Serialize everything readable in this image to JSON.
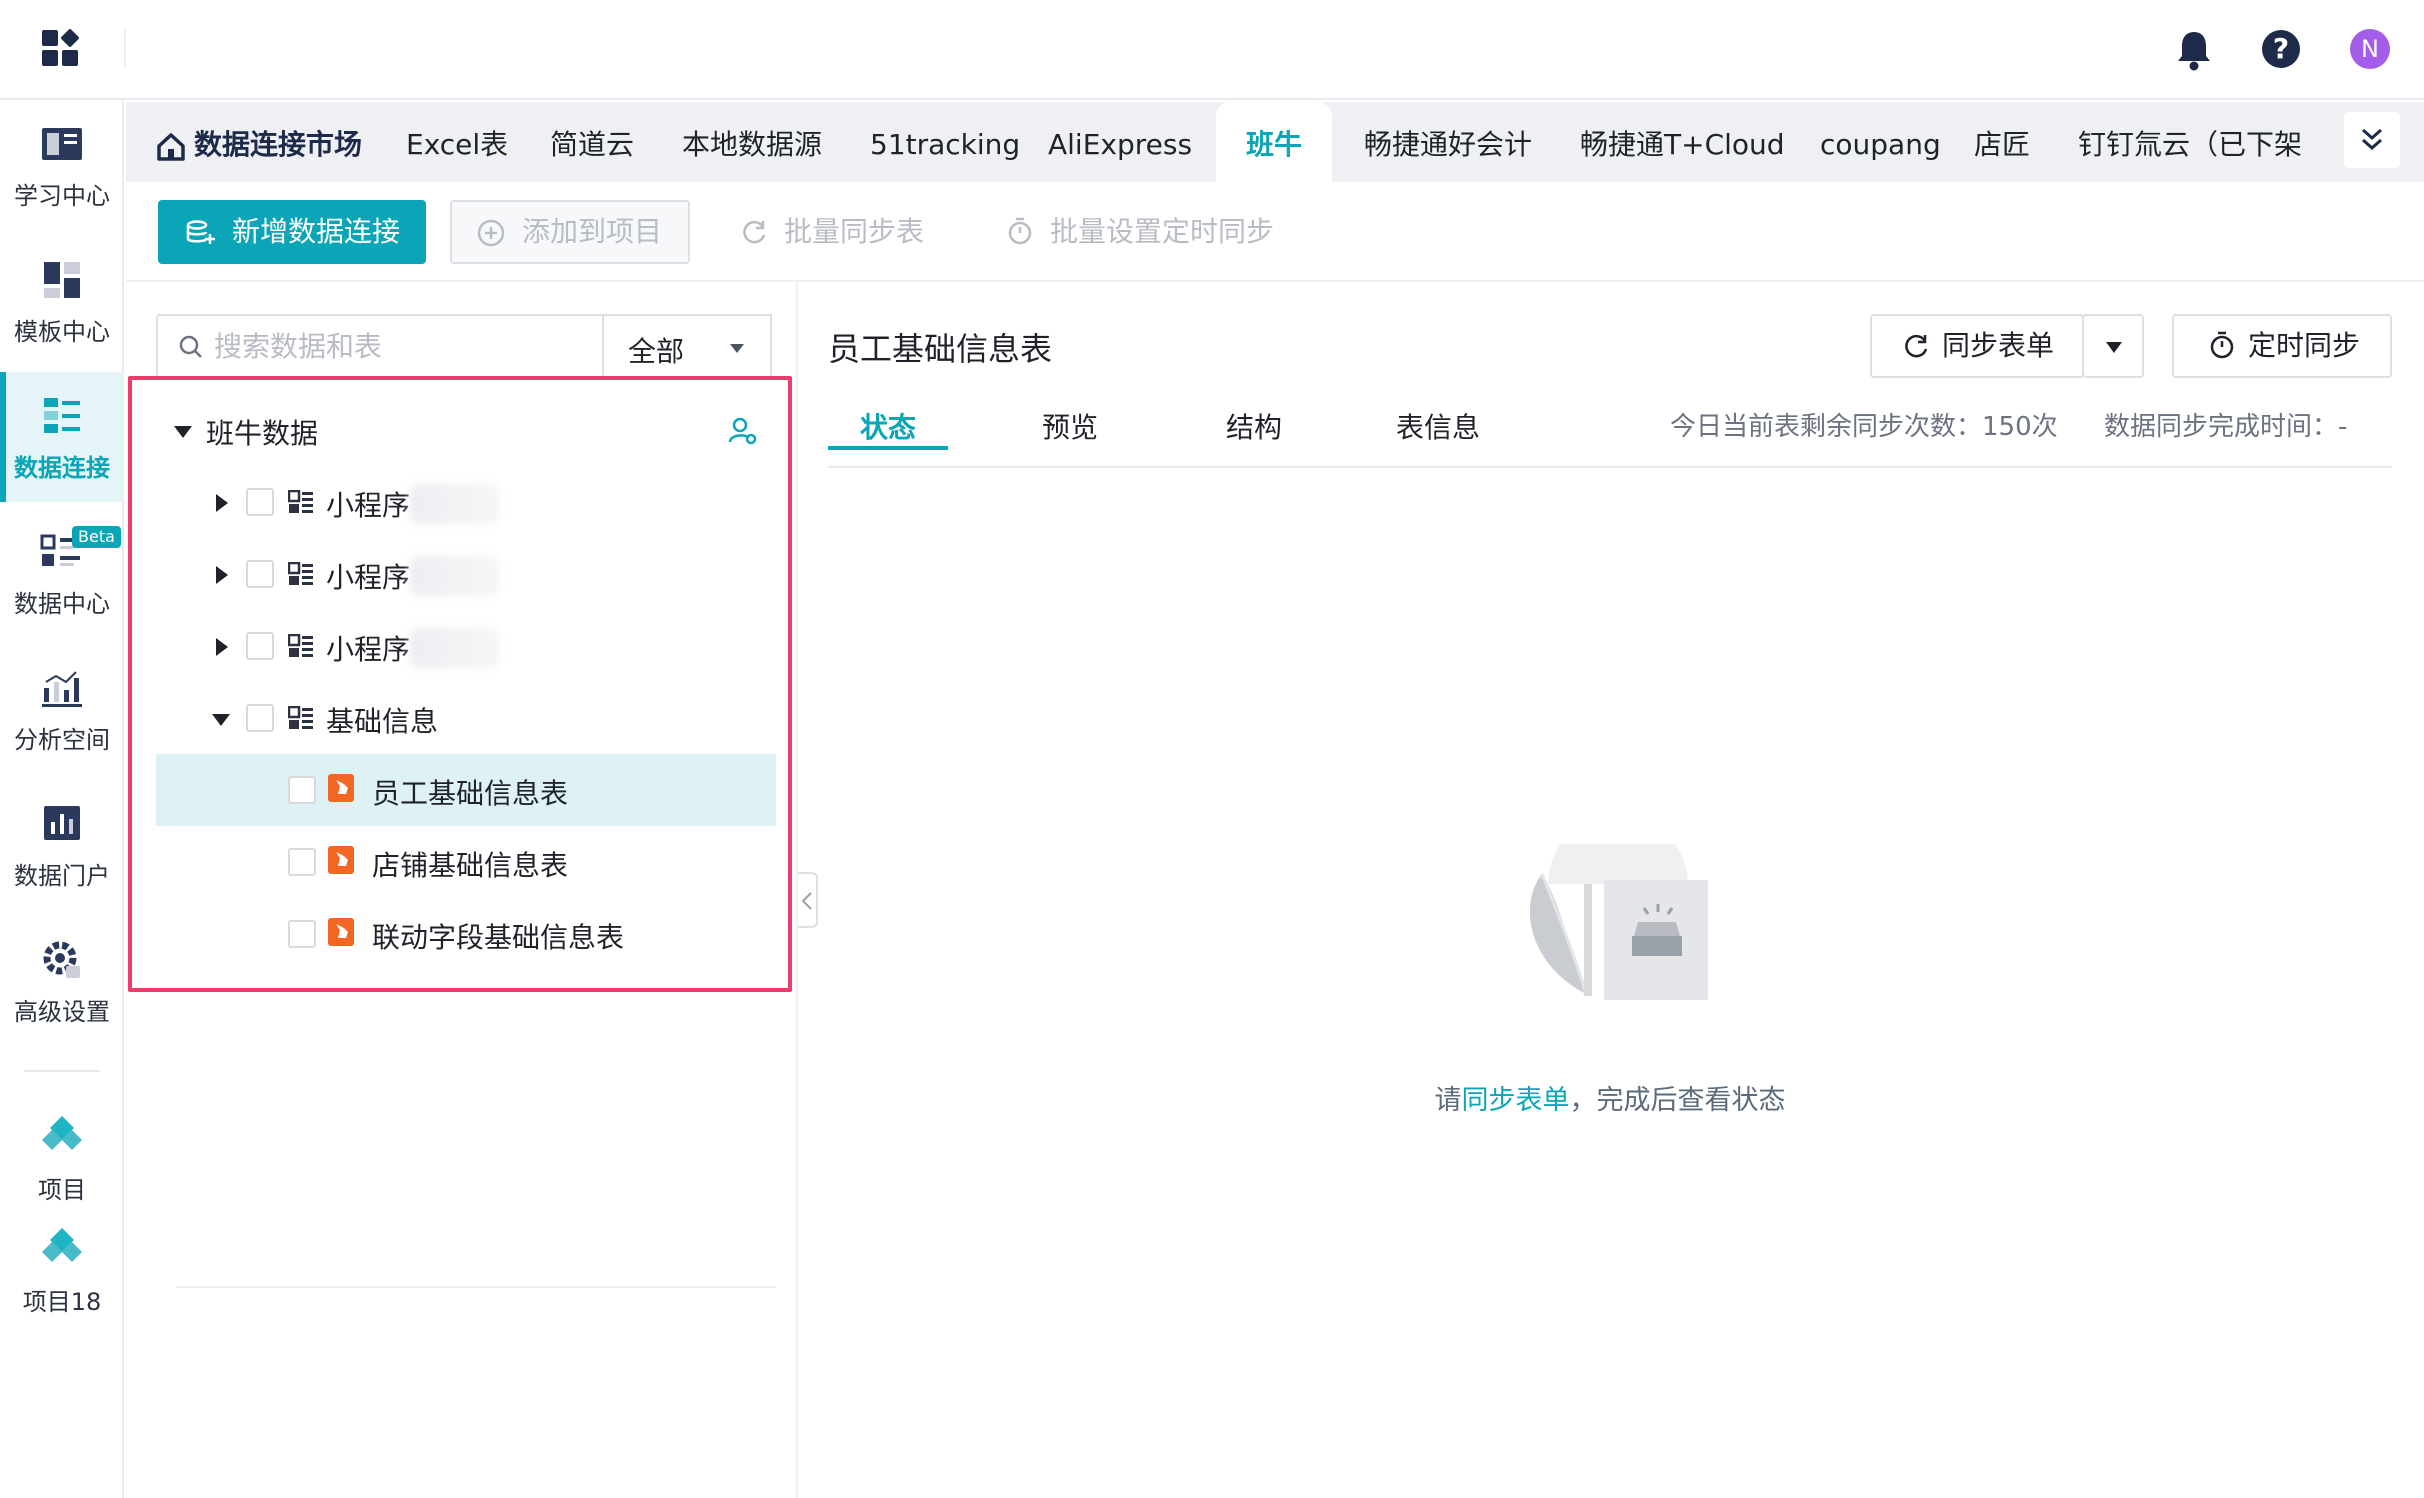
{
  "topbar": {
    "avatar_letter": "N",
    "help_symbol": "?"
  },
  "sidenav": {
    "items": [
      {
        "label": "学习中心",
        "icon": "learning-center-icon"
      },
      {
        "label": "模板中心",
        "icon": "template-center-icon"
      },
      {
        "label": "数据连接",
        "icon": "data-connection-icon",
        "active": true
      },
      {
        "label": "数据中心",
        "icon": "data-center-icon",
        "badge": "Beta"
      },
      {
        "label": "分析空间",
        "icon": "analysis-space-icon"
      },
      {
        "label": "数据门户",
        "icon": "data-portal-icon"
      },
      {
        "label": "高级设置",
        "icon": "advanced-settings-icon"
      }
    ],
    "projects": [
      {
        "label": "项目",
        "icon": "project-icon"
      },
      {
        "label": "项目18",
        "icon": "project-icon"
      }
    ]
  },
  "tabs": {
    "market": "数据连接市场",
    "items": [
      "Excel表",
      "简道云",
      "本地数据源",
      "51tracking",
      "AliExpress",
      "班牛",
      "畅捷通好会计",
      "畅捷通T+Cloud",
      "coupang",
      "店匠",
      "钉钉氚云（已下架"
    ],
    "active": "班牛"
  },
  "toolbar": {
    "new_connection": "新增数据连接",
    "add_to_project": "添加到项目",
    "batch_sync": "批量同步表",
    "batch_schedule": "批量设置定时同步"
  },
  "tree": {
    "search_placeholder": "搜索数据和表",
    "filter_value": "全部",
    "root_label": "班牛数据",
    "groups": [
      {
        "label": "小程序",
        "expanded": false
      },
      {
        "label": "小程序",
        "expanded": false
      },
      {
        "label": "小程序",
        "expanded": false
      },
      {
        "label": "基础信息",
        "expanded": true
      }
    ],
    "tables": [
      {
        "label": "员工基础信息表",
        "selected": true
      },
      {
        "label": "店铺基础信息表",
        "selected": false
      },
      {
        "label": "联动字段基础信息表",
        "selected": false
      }
    ]
  },
  "detail": {
    "title": "员工基础信息表",
    "sync_button": "同步表单",
    "schedule_button": "定时同步",
    "tabs": [
      "状态",
      "预览",
      "结构",
      "表信息"
    ],
    "active_tab": "状态",
    "remaining_sync": "今日当前表剩余同步次数：150次",
    "sync_complete_time": "数据同步完成时间：-",
    "empty_prefix": "请",
    "empty_link": "同步表单",
    "empty_suffix": "，完成后查看状态"
  },
  "colors": {
    "accent": "#0aa5b6",
    "navy": "#1e2a4a",
    "highlight_border": "#ea3d6c",
    "avatar": "#a35de8",
    "sheet_icon": "#f26722"
  }
}
